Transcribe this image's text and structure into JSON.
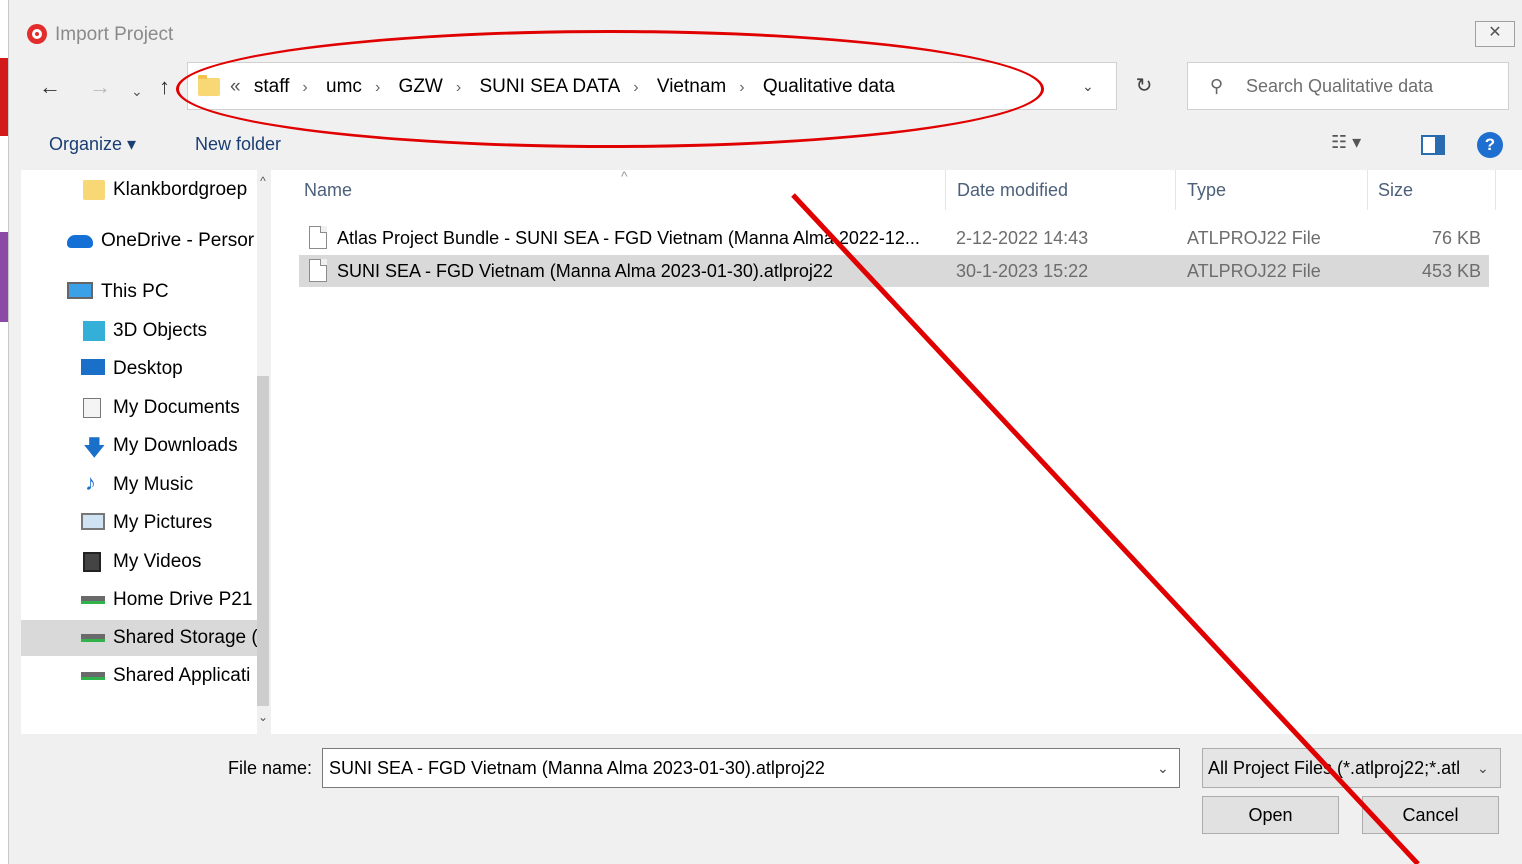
{
  "window": {
    "title": "Import Project",
    "close_glyph": "✕"
  },
  "nav": {
    "back_glyph": "←",
    "forward_glyph": "→",
    "recent_glyph": "⌄",
    "up_glyph": "↑",
    "address": {
      "lead": "«",
      "crumbs": [
        "staff",
        "umc",
        "GZW",
        "SUNI SEA DATA",
        "Vietnam",
        "Qualitative data"
      ],
      "separator": "›",
      "dropdown_glyph": "⌄"
    },
    "refresh_glyph": "↻",
    "search": {
      "placeholder": "Search Qualitative data",
      "icon_glyph": "⚲"
    }
  },
  "toolbar": {
    "organize_label": "Organize ▾",
    "new_folder_label": "New folder",
    "view_glyph": "☷ ▾",
    "help_glyph": "?"
  },
  "sidebar": {
    "items": [
      {
        "label": "Klankbordgroep",
        "icon": "folder-icon"
      },
      {
        "label": "OneDrive - Persor",
        "icon": "onedrive-icon"
      },
      {
        "label": "This PC",
        "icon": "pc-icon"
      },
      {
        "label": "3D Objects",
        "icon": "3d-objects-icon"
      },
      {
        "label": "Desktop",
        "icon": "desktop-icon"
      },
      {
        "label": "My Documents",
        "icon": "documents-icon"
      },
      {
        "label": "My Downloads",
        "icon": "downloads-icon"
      },
      {
        "label": "My Music",
        "icon": "music-icon"
      },
      {
        "label": "My Pictures",
        "icon": "pictures-icon"
      },
      {
        "label": "My Videos",
        "icon": "videos-icon"
      },
      {
        "label": "Home Drive P21",
        "icon": "network-drive-icon"
      },
      {
        "label": "Shared Storage (",
        "icon": "network-drive-icon",
        "selected": true
      },
      {
        "label": "Shared Applicati",
        "icon": "network-drive-icon"
      }
    ],
    "scroll_up_glyph": "^",
    "scroll_down_glyph": "⌄"
  },
  "filelist": {
    "columns": [
      "Name",
      "Date modified",
      "Type",
      "Size"
    ],
    "sort_glyph": "^",
    "rows": [
      {
        "name": "Atlas Project Bundle - SUNI SEA - FGD Vietnam (Manna Alma 2022-12...",
        "date": "2-12-2022 14:43",
        "type": "ATLPROJ22 File",
        "size": "76 KB"
      },
      {
        "name": "SUNI SEA - FGD Vietnam (Manna Alma 2023-01-30).atlproj22",
        "date": "30-1-2023 15:22",
        "type": "ATLPROJ22 File",
        "size": "453 KB",
        "selected": true
      }
    ]
  },
  "bottom": {
    "filename_label": "File name:",
    "filename_value": "SUNI SEA - FGD Vietnam (Manna Alma 2023-01-30).atlproj22",
    "filename_dropdown_glyph": "⌄",
    "filetype_value": "All Project Files (*.atlproj22;*.atl",
    "filetype_dropdown_glyph": "⌄",
    "open_label": "Open",
    "cancel_label": "Cancel"
  },
  "colors": {
    "annotation": "#e00000",
    "link": "#1a3e72",
    "selected_row": "#d9d9d9"
  }
}
